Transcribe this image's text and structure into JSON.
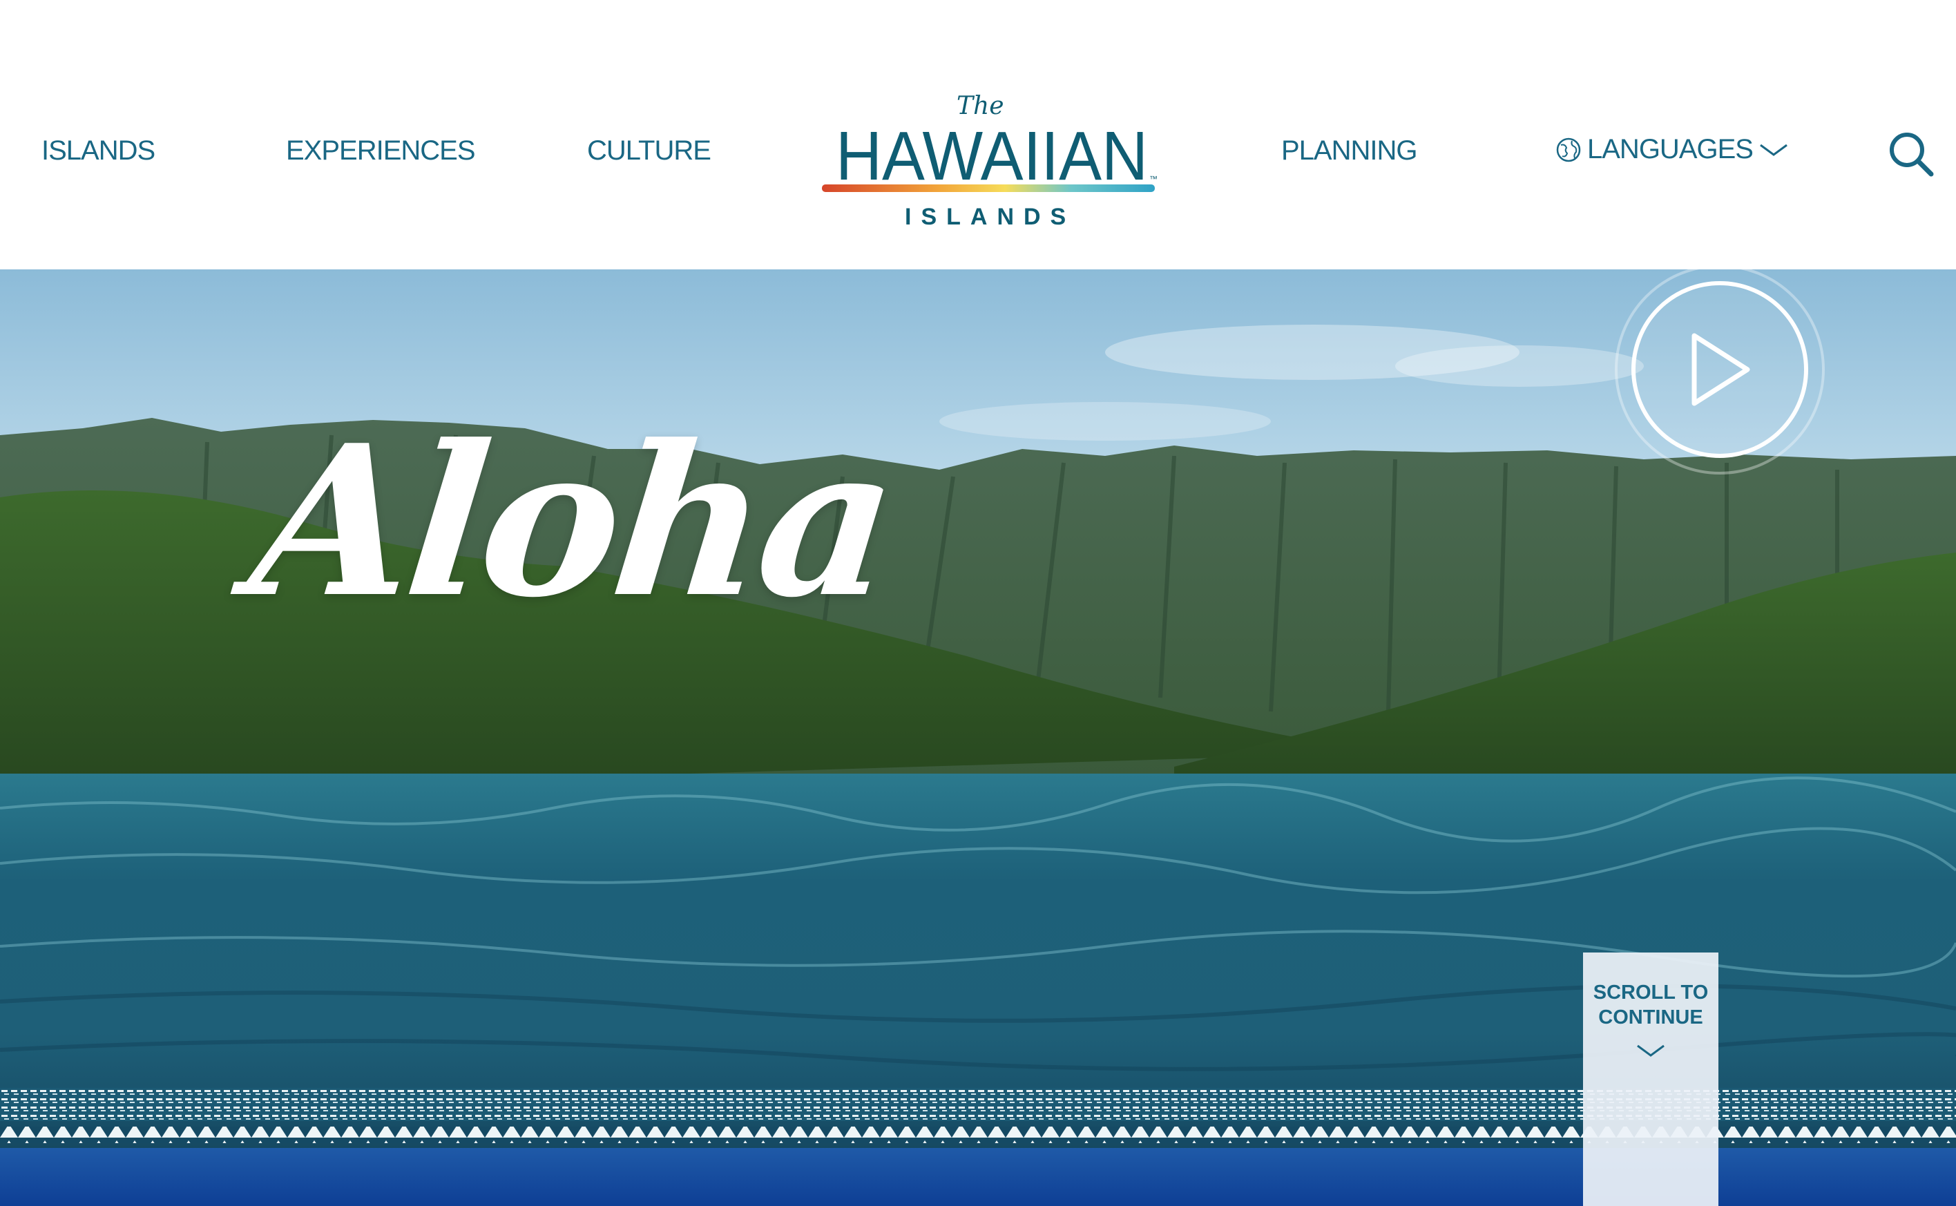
{
  "header": {
    "nav_left": [
      "ISLANDS",
      "EXPERIENCES",
      "CULTURE"
    ],
    "nav_right": [
      "PLANNING"
    ],
    "languages_label": "LANGUAGES",
    "logo": {
      "the": "The",
      "brand": "HAWAIIAN",
      "sub": "ISLANDS",
      "tm": "™"
    },
    "icons": [
      "globe-icon",
      "chevron-down-icon",
      "search-icon"
    ]
  },
  "hero": {
    "headline": "Aloha",
    "play_icon": "play-icon",
    "scroll_label_line1": "SCROLL TO",
    "scroll_label_line2": "CONTINUE"
  },
  "colors": {
    "brand_teal": "#1a6784",
    "band_blue": "#134a9e",
    "white": "#ffffff"
  }
}
